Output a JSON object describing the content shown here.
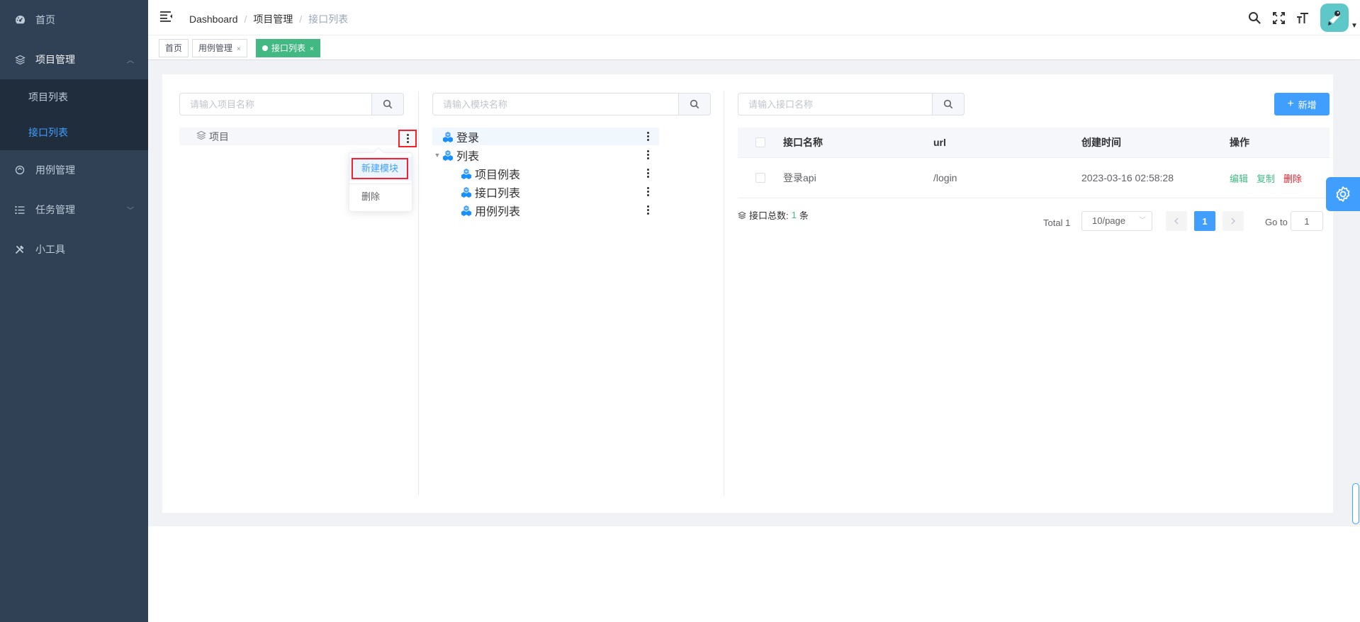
{
  "sidebar": {
    "items": [
      {
        "label": "首页",
        "icon": "dashboard-icon"
      },
      {
        "label": "项目管理",
        "icon": "layers-icon",
        "expanded": true,
        "children": [
          {
            "label": "项目列表"
          },
          {
            "label": "接口列表",
            "active": true
          }
        ]
      },
      {
        "label": "用例管理",
        "icon": "case-icon"
      },
      {
        "label": "任务管理",
        "icon": "task-list-icon",
        "expanded": false
      },
      {
        "label": "小工具",
        "icon": "tools-icon"
      }
    ]
  },
  "navbar": {
    "breadcrumb": [
      "Dashboard",
      "项目管理",
      "接口列表"
    ],
    "icons": [
      "search-icon",
      "fullscreen-icon",
      "font-size-icon"
    ]
  },
  "tags": [
    {
      "label": "首页"
    },
    {
      "label": "用例管理",
      "close": "×"
    },
    {
      "label": "接口列表",
      "close": "×",
      "active": true
    }
  ],
  "project_panel": {
    "search_placeholder": "请输入项目名称",
    "tree_node": "项目",
    "dropdown": {
      "create_module": "新建模块",
      "delete": "删除"
    }
  },
  "module_panel": {
    "search_placeholder": "请输入模块名称",
    "nodes": [
      {
        "label": "登录",
        "selected": true
      },
      {
        "label": "列表",
        "expanded": true
      },
      {
        "label": "项目例表"
      },
      {
        "label": "接口列表"
      },
      {
        "label": "用例列表"
      }
    ]
  },
  "api_panel": {
    "search_placeholder": "请输入接口名称",
    "add_button": "新增",
    "table": {
      "headers": [
        "接口名称",
        "url",
        "创建时间",
        "操作"
      ],
      "rows": [
        {
          "name": "登录api",
          "url": "/login",
          "created": "2023-03-16 02:58:28",
          "ops": [
            "编辑",
            "复制",
            "删除"
          ]
        }
      ]
    },
    "total": {
      "label": "接口总数:",
      "count": "1",
      "unit": "条"
    },
    "pagination": {
      "total": "Total 1",
      "page_size": "10/page",
      "current": "1",
      "goto_label": "Go to",
      "goto_value": "1"
    }
  },
  "colors": {
    "sidebar_bg": "#304156",
    "accent": "#409eff",
    "tag_active": "#42b983",
    "danger": "#f5222d"
  }
}
